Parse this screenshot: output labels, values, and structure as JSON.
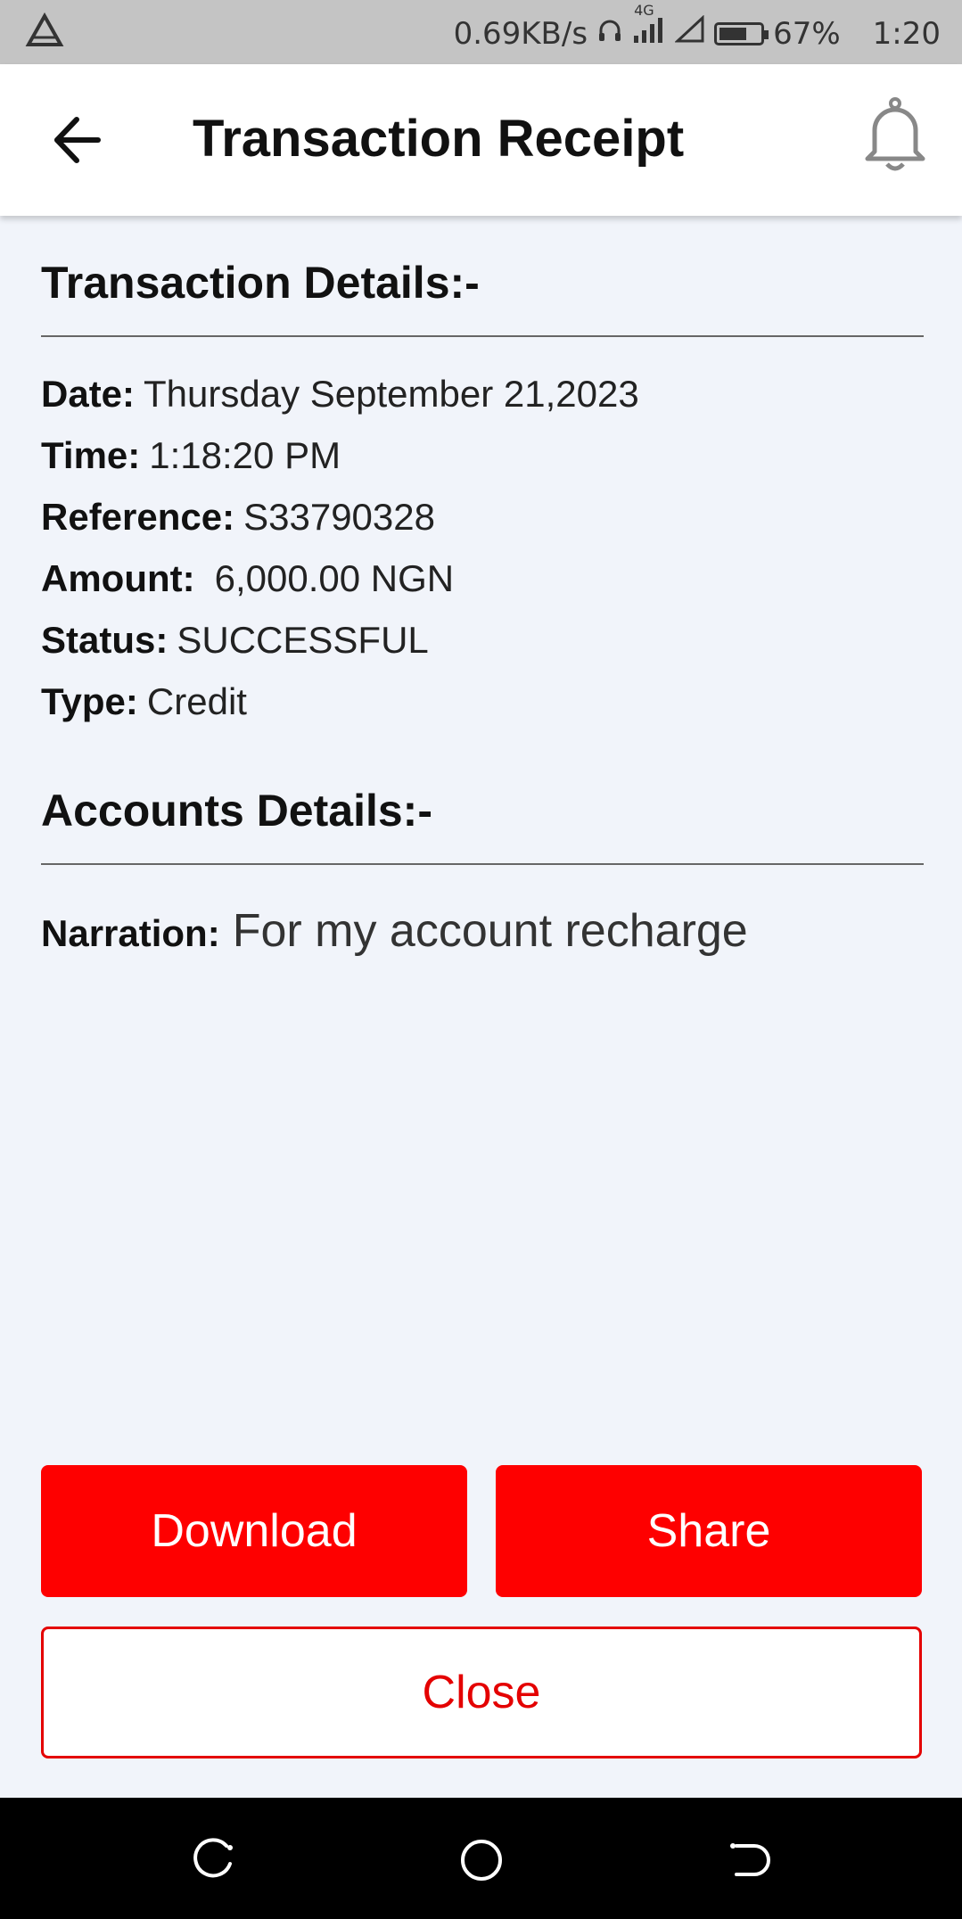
{
  "status_bar": {
    "net_speed": "0.69KB/s",
    "network_type": "4G",
    "battery": "67%",
    "battery_level": 0.67,
    "time": "1:20",
    "icons": [
      "alert-triangle-icon",
      "headset-icon",
      "signal-icon",
      "signal-outline-icon",
      "battery-icon"
    ]
  },
  "app_bar": {
    "title": "Transaction Receipt",
    "icons": [
      "back-arrow-icon",
      "bell-icon"
    ]
  },
  "transaction_section": {
    "title": "Transaction Details:-",
    "rows": [
      {
        "label": "Date:",
        "value": "Thursday September 21,2023"
      },
      {
        "label": "Time:",
        "value": "1:18:20 PM"
      },
      {
        "label": "Reference:",
        "value": "S33790328"
      },
      {
        "label": "Amount:",
        "value": "6,000.00 NGN"
      },
      {
        "label": "Status:",
        "value": "SUCCESSFUL"
      },
      {
        "label": "Type:",
        "value": "Credit"
      }
    ]
  },
  "accounts_section": {
    "title": "Accounts Details:-",
    "narration_label": "Narration:",
    "narration_value": "For my account recharge"
  },
  "actions": {
    "download": "Download",
    "share": "Share",
    "close": "Close"
  },
  "colors": {
    "primary_red": "#fe0000",
    "outline_red": "#e40000",
    "page_bg": "#f1f4fa"
  },
  "nav_bar": {
    "icons": [
      "recents-icon",
      "home-icon",
      "back-icon"
    ]
  }
}
